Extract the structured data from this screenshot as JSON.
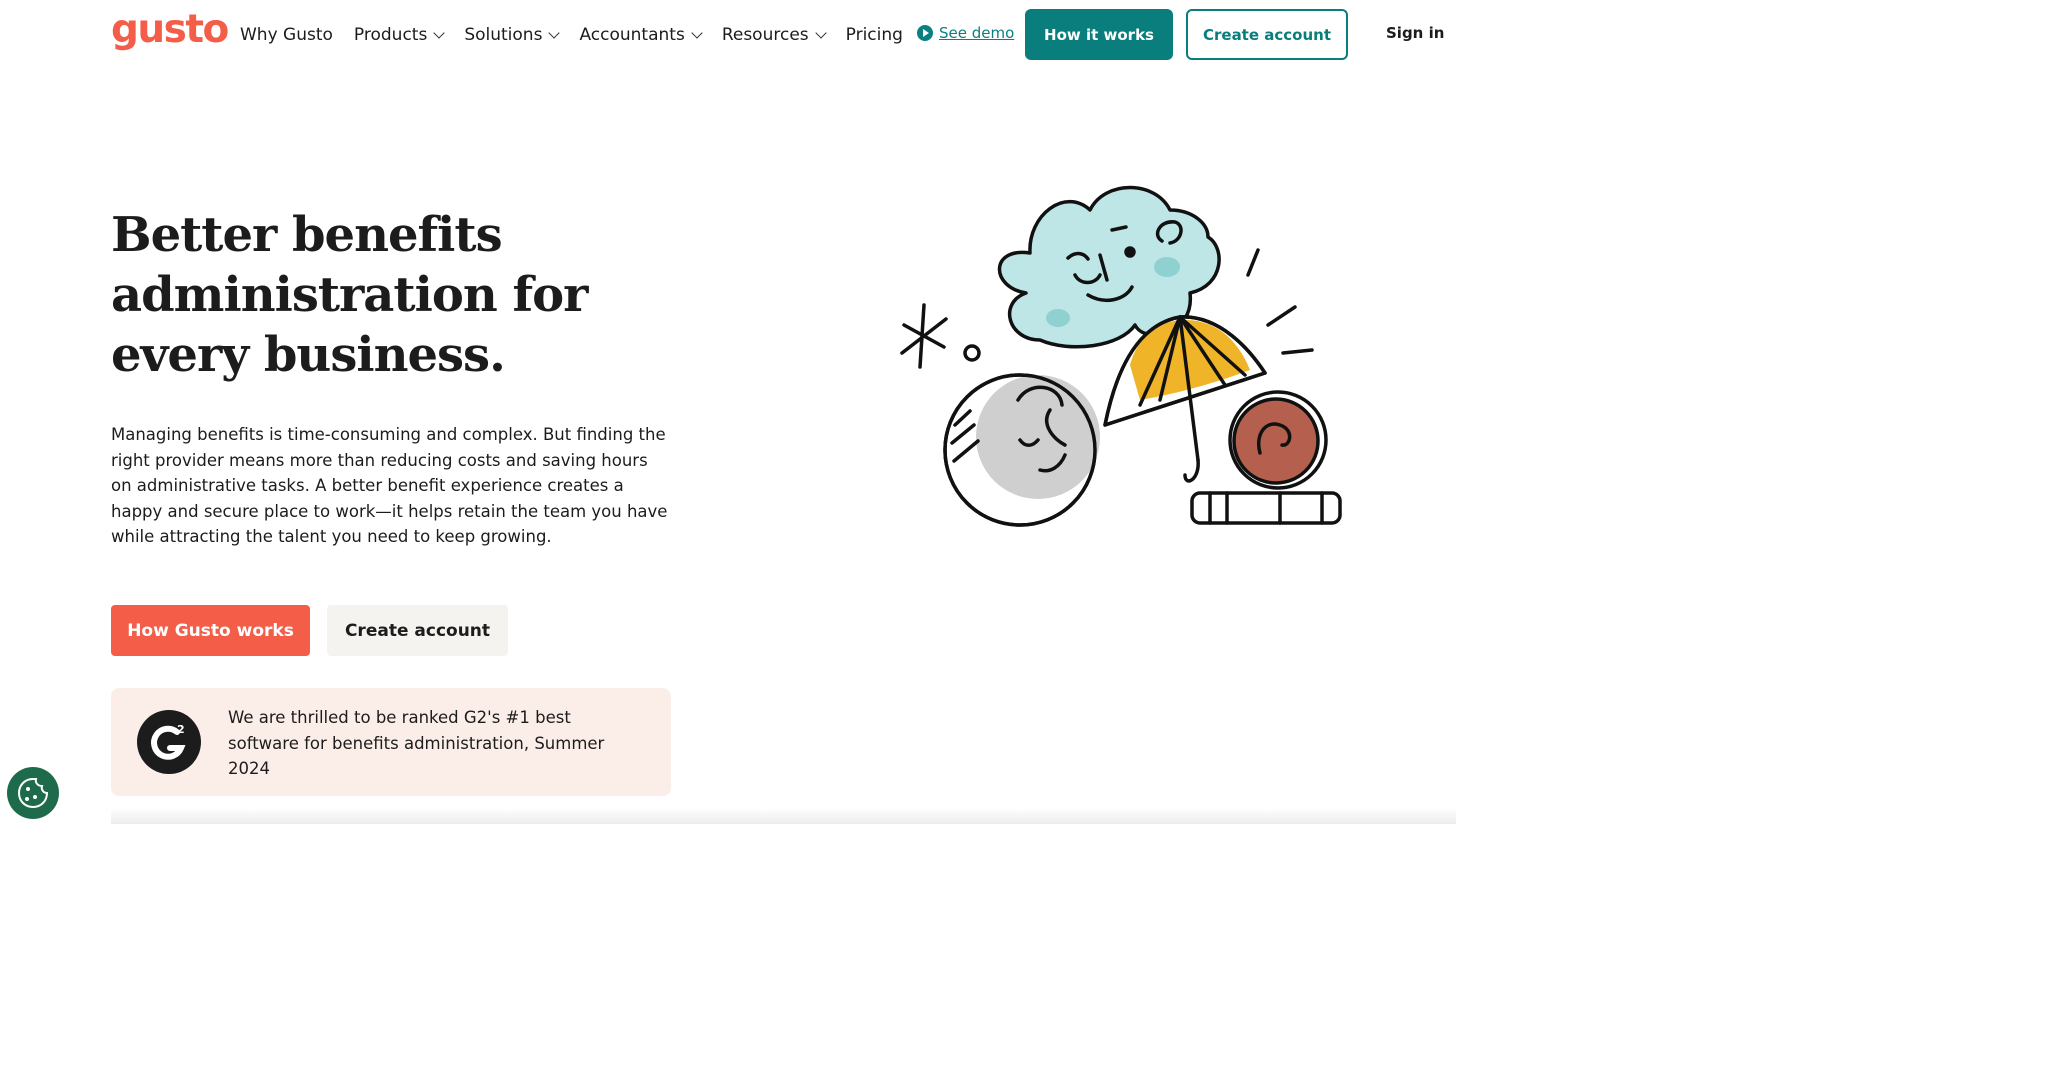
{
  "header": {
    "logo": "gusto",
    "nav": [
      {
        "label": "Why Gusto",
        "has_dropdown": false
      },
      {
        "label": "Products",
        "has_dropdown": true
      },
      {
        "label": "Solutions",
        "has_dropdown": true
      },
      {
        "label": "Accountants",
        "has_dropdown": true
      },
      {
        "label": "Resources",
        "has_dropdown": true
      },
      {
        "label": "Pricing",
        "has_dropdown": false
      }
    ],
    "demo_link": "See demo",
    "how_it_works": "How it works",
    "create_account": "Create account",
    "sign_in": "Sign in"
  },
  "hero": {
    "title": "Better benefits administration for every business.",
    "description": "Managing benefits is time-consuming and complex. But finding the right provider means more than reducing costs and saving hours on administrative tasks. A better benefit experience creates a happy and secure place to work—it helps retain the team you have while attracting the talent you need to keep growing.",
    "primary_cta": "How Gusto works",
    "secondary_cta": "Create account"
  },
  "award": {
    "badge_icon": "g2-logo-icon",
    "text": "We are thrilled to be ranked G2's #1 best software for benefits administration, Summer 2024"
  },
  "colors": {
    "brand": "#f45d48",
    "teal": "#0a7d7d",
    "award_bg": "#fbeee8",
    "cookie": "#1e6b4b"
  }
}
